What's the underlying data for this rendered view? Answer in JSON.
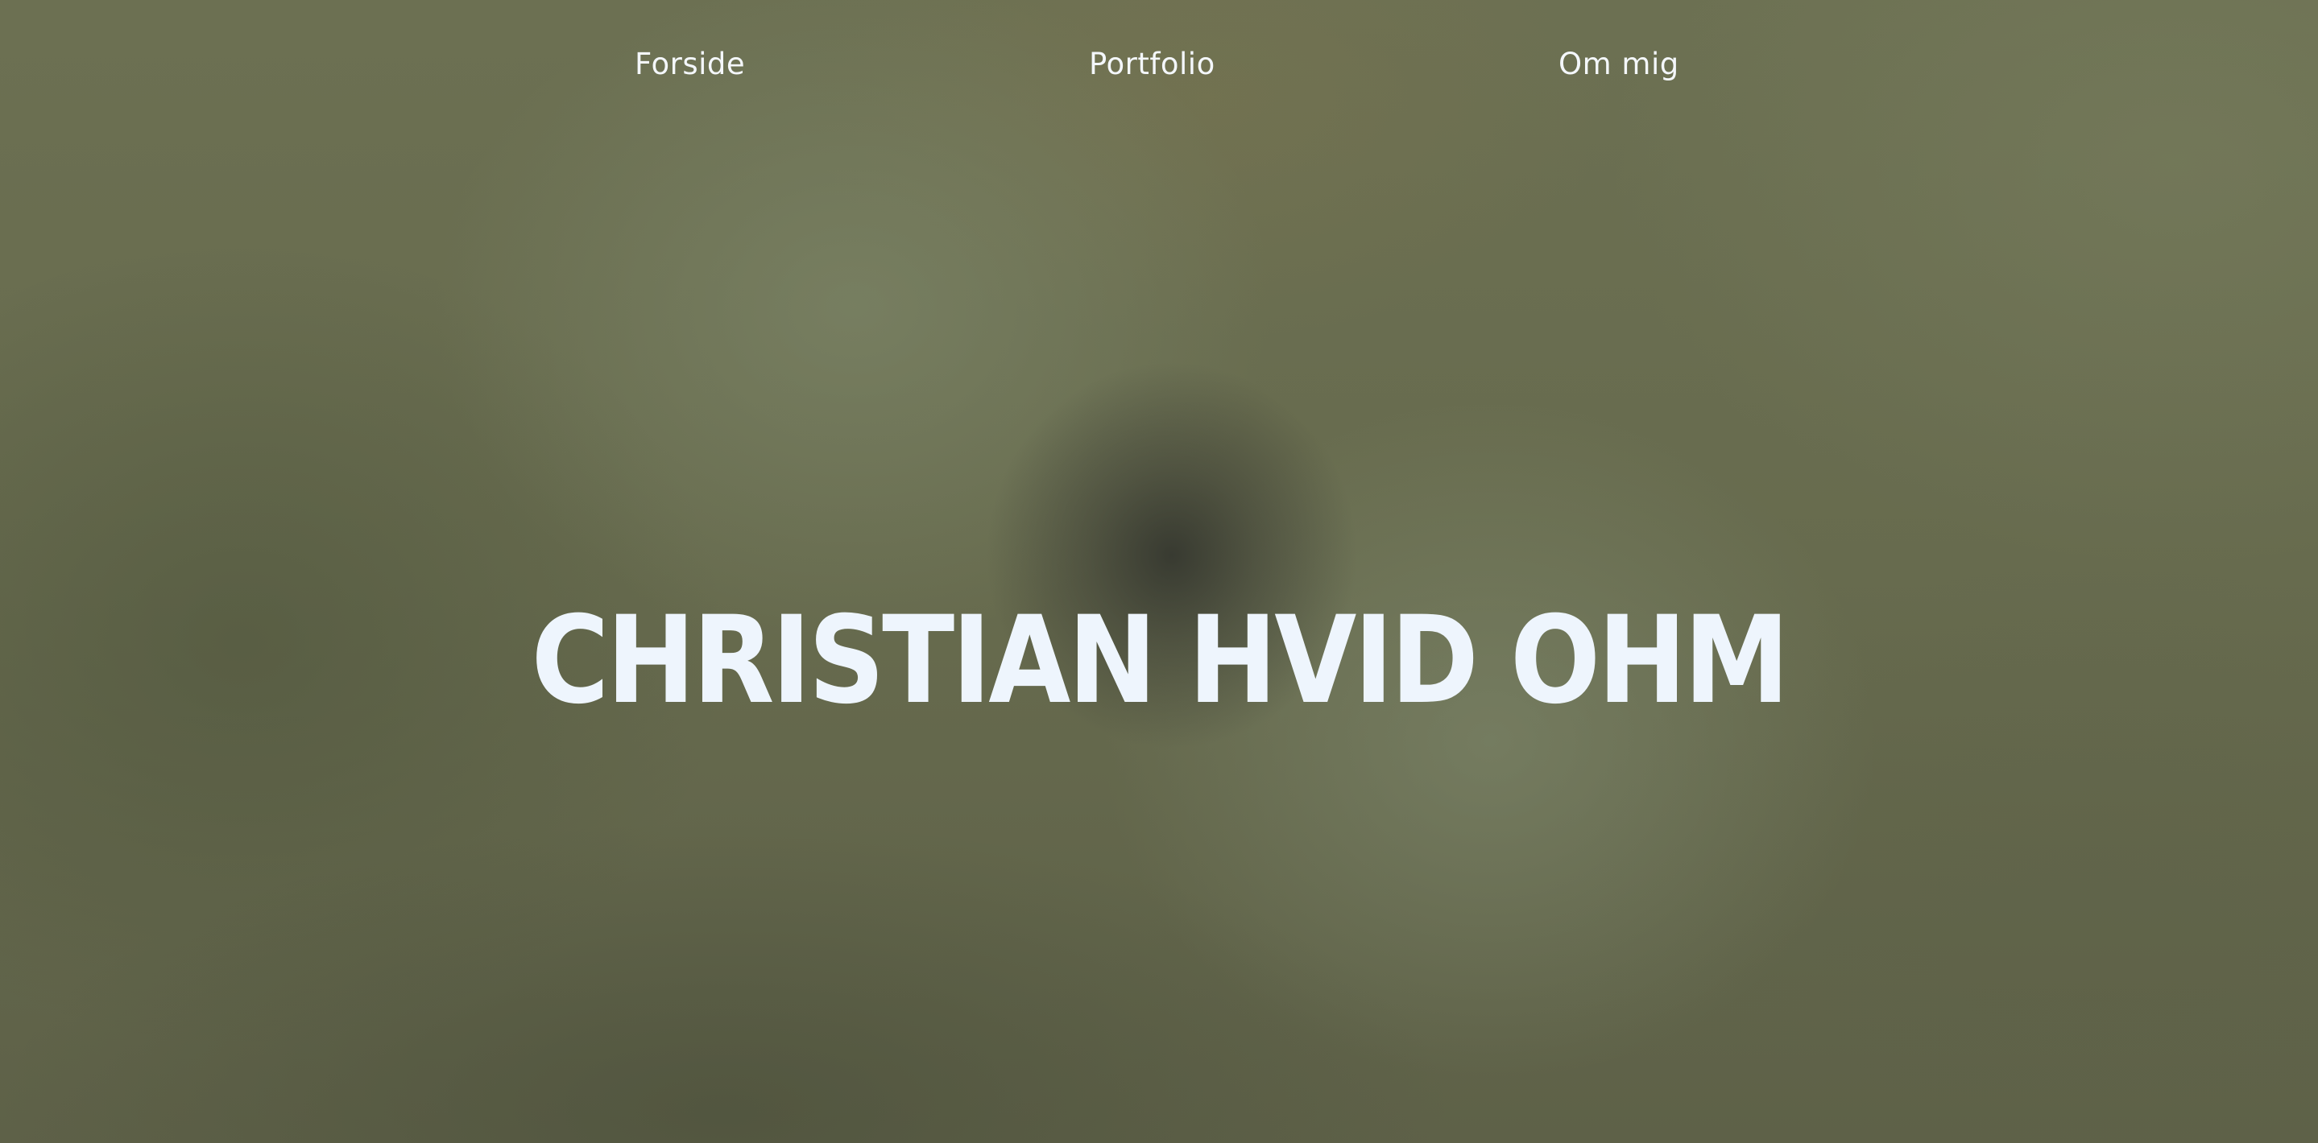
{
  "nav": {
    "items": [
      {
        "label": "Forside"
      },
      {
        "label": "Portfolio"
      },
      {
        "label": "Om mig"
      }
    ]
  },
  "hero": {
    "title": "CHRISTIAN HVID OHM"
  },
  "colors": {
    "text": "#eef5fd",
    "background": "#66694e"
  }
}
